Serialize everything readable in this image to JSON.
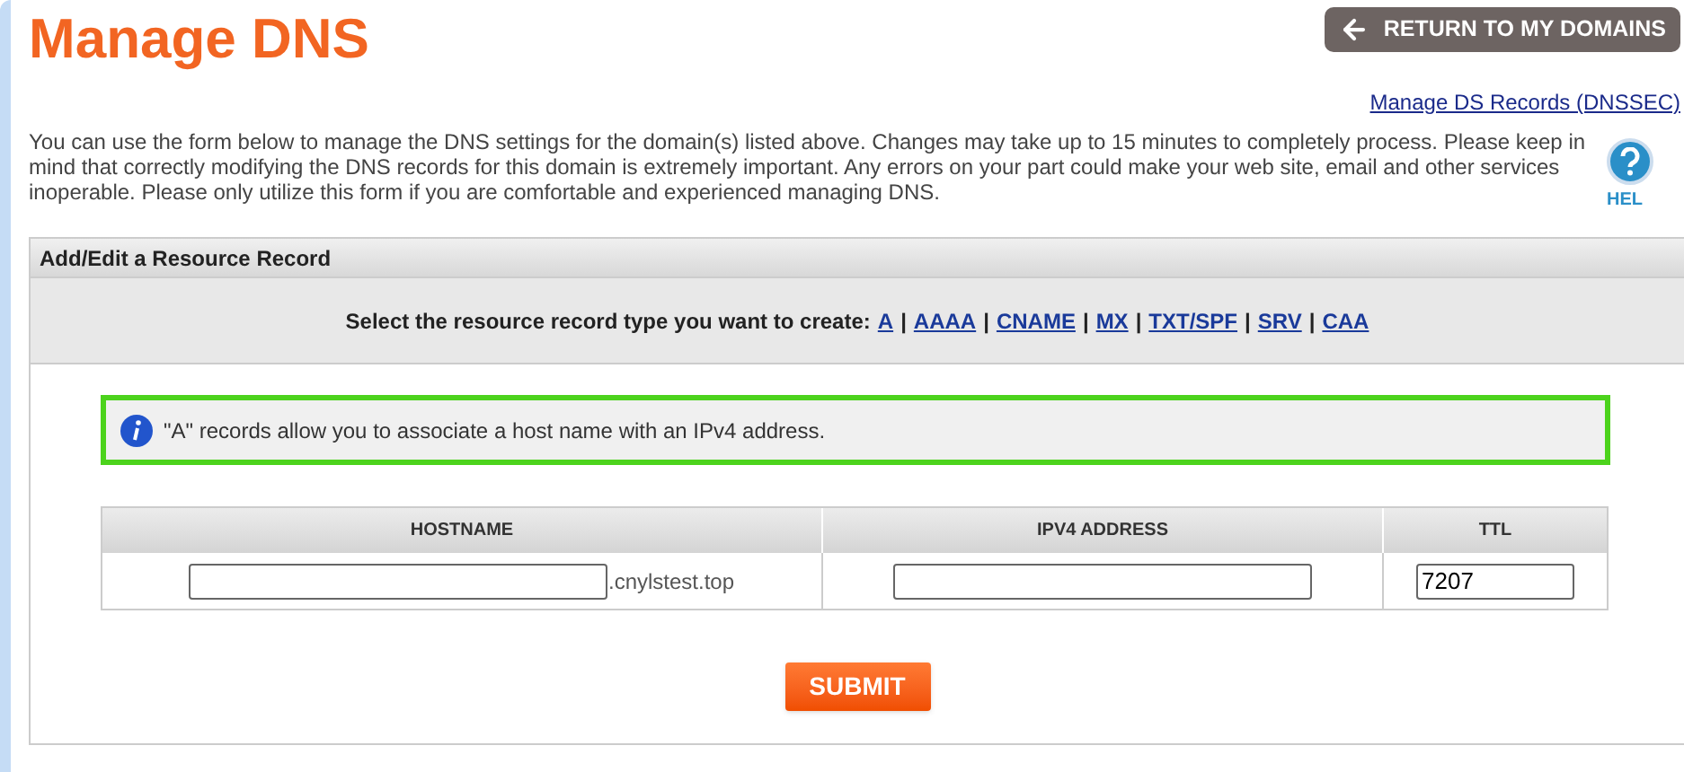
{
  "title": "Manage DNS",
  "return_button": "RETURN TO MY DOMAINS",
  "dnssec_link": "Manage DS Records (DNSSEC)",
  "intro": "You can use the form below to manage the DNS settings for the domain(s) listed above. Changes may take up to 15 minutes to completely process. Please keep in mind that correctly modifying the DNS records for this domain is extremely important. Any errors on your part could make your web site, email and other services inoperable. Please only utilize this form if you are comfortable and experienced managing DNS.",
  "help_label": "HEL",
  "panel": {
    "title": "Add/Edit a Resource Record",
    "type_prompt": "Select the resource record type you want to create:",
    "record_types": [
      "A",
      "AAAA",
      "CNAME",
      "MX",
      "TXT/SPF",
      "SRV",
      "CAA"
    ],
    "separators": [
      "|",
      "|",
      "|",
      "|",
      "|",
      "|"
    ],
    "info": "\"A\" records allow you to associate a host name with an IPv4 address.",
    "table": {
      "columns": [
        "HOSTNAME",
        "IPV4 ADDRESS",
        "TTL"
      ],
      "hostname_suffix": ".cnylstest.top",
      "ttl_value": "7207"
    },
    "submit": "SUBMIT"
  }
}
